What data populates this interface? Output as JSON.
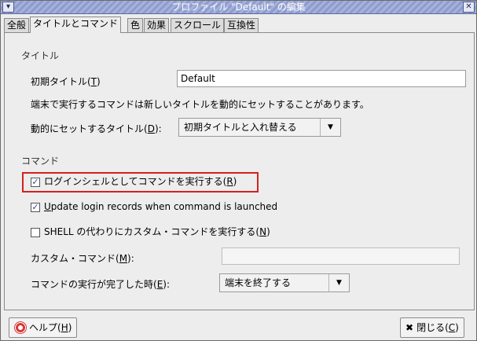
{
  "window": {
    "title": "プロファイル \"Default\" の編集",
    "menu_icon": "chevron-down-icon",
    "close_icon": "close-icon"
  },
  "tabs": [
    {
      "label": "全般"
    },
    {
      "label": "タイトルとコマンド"
    },
    {
      "label": "色"
    },
    {
      "label": "効果"
    },
    {
      "label": "スクロール"
    },
    {
      "label": "互換性"
    }
  ],
  "title_section": {
    "heading": "タイトル",
    "initial_title_label": "初期タイトル(",
    "initial_title_key": "T",
    "initial_title_value": "Default",
    "info_text": "端末で実行するコマンドは新しいタイトルを動的にセットすることがあります。",
    "dynamic_title_label": "動的にセットするタイトル(",
    "dynamic_title_key": "D",
    "dynamic_title_value": "初期タイトルと入れ替える"
  },
  "command_section": {
    "heading": "コマンド",
    "login_shell_label": "ログインシェルとしてコマンドを実行する(",
    "login_shell_key": "R",
    "login_shell_checked": true,
    "update_records_key": "U",
    "update_records_label": "pdate login records when command is launched",
    "update_records_checked": true,
    "custom_cmd_check_label": "SHELL の代わりにカスタム・コマンドを実行する(",
    "custom_cmd_check_key": "N",
    "custom_cmd_checked": false,
    "custom_cmd_label": "カスタム・コマンド(",
    "custom_cmd_key": "M",
    "custom_cmd_value": "",
    "on_exit_label": "コマンドの実行が完了した時(",
    "on_exit_key": "E",
    "on_exit_value": "端末を終了する"
  },
  "footer": {
    "help_label": "ヘルプ(",
    "help_key": "H",
    "close_label": "閉じる(",
    "close_key": "C"
  },
  "colors": {
    "highlight": "#d62020",
    "titlebar": "#8d9ccd"
  }
}
